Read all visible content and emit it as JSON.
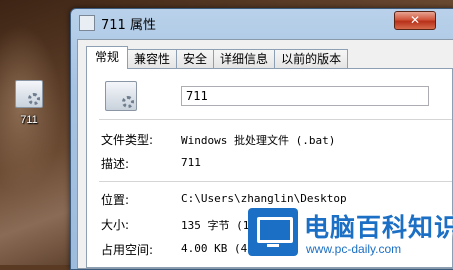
{
  "desktop": {
    "icon_label": "711"
  },
  "window": {
    "title": "711 属性",
    "close_symbol": "✕",
    "tabs": [
      {
        "label": "常规",
        "active": true
      },
      {
        "label": "兼容性",
        "active": false
      },
      {
        "label": "安全",
        "active": false
      },
      {
        "label": "详细信息",
        "active": false
      },
      {
        "label": "以前的版本",
        "active": false
      }
    ],
    "file_name": "711",
    "rows": {
      "type_label": "文件类型:",
      "type_value": "Windows 批处理文件 (.bat)",
      "desc_label": "描述:",
      "desc_value": "711",
      "location_label": "位置:",
      "location_value": "C:\\Users\\zhanglin\\Desktop",
      "size_label": "大小:",
      "size_value": "135 字节 (135",
      "disk_label": "占用空间:",
      "disk_value": "4.00 KB (4,0"
    }
  },
  "watermark": {
    "title": "电脑百科知识",
    "url": "www.pc-daily.com",
    "brand_color": "#1b6fc4"
  }
}
